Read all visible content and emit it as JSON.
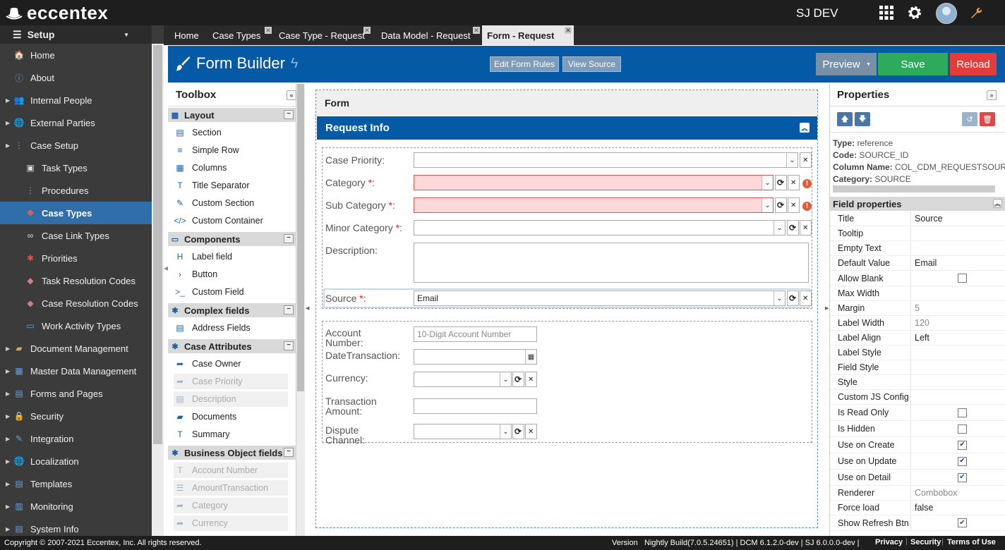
{
  "topbar": {
    "logo": "eccentex",
    "user": "SJ DEV"
  },
  "sidebar": {
    "header": "Setup",
    "items": [
      {
        "label": "Home",
        "icon": "home-icon",
        "indent": 0,
        "arrow": false
      },
      {
        "label": "About",
        "icon": "info-icon",
        "indent": 0,
        "arrow": false
      },
      {
        "label": "Internal People",
        "icon": "people-icon",
        "indent": 0,
        "arrow": true
      },
      {
        "label": "External Parties",
        "icon": "globe-icon",
        "indent": 0,
        "arrow": true
      },
      {
        "label": "Case Setup",
        "icon": "tree-icon",
        "indent": 0,
        "arrow": true
      },
      {
        "label": "Task Types",
        "icon": "cube-icon",
        "indent": 1,
        "arrow": false
      },
      {
        "label": "Procedures",
        "icon": "procedure-icon",
        "indent": 1,
        "arrow": false
      },
      {
        "label": "Case Types",
        "icon": "case-types-icon",
        "indent": 1,
        "arrow": false,
        "active": true
      },
      {
        "label": "Case Link Types",
        "icon": "link-icon",
        "indent": 1,
        "arrow": false
      },
      {
        "label": "Priorities",
        "icon": "priority-icon",
        "indent": 1,
        "arrow": false
      },
      {
        "label": "Task Resolution Codes",
        "icon": "tag-icon",
        "indent": 1,
        "arrow": false
      },
      {
        "label": "Case Resolution Codes",
        "icon": "tag-icon",
        "indent": 1,
        "arrow": false
      },
      {
        "label": "Work Activity Types",
        "icon": "activity-icon",
        "indent": 1,
        "arrow": false
      },
      {
        "label": "Document Management",
        "icon": "folder-icon",
        "indent": 0,
        "arrow": true
      },
      {
        "label": "Master Data Management",
        "icon": "grid-icon",
        "indent": 0,
        "arrow": true
      },
      {
        "label": "Forms and Pages",
        "icon": "form-icon",
        "indent": 0,
        "arrow": true
      },
      {
        "label": "Security",
        "icon": "lock-icon",
        "indent": 0,
        "arrow": true
      },
      {
        "label": "Integration",
        "icon": "plug-icon",
        "indent": 0,
        "arrow": true
      },
      {
        "label": "Localization",
        "icon": "globe-icon",
        "indent": 0,
        "arrow": true
      },
      {
        "label": "Templates",
        "icon": "template-icon",
        "indent": 0,
        "arrow": true
      },
      {
        "label": "Monitoring",
        "icon": "monitor-icon",
        "indent": 0,
        "arrow": true
      },
      {
        "label": "System Info",
        "icon": "system-icon",
        "indent": 0,
        "arrow": true
      }
    ]
  },
  "tabs": [
    {
      "label": "Home",
      "closable": false
    },
    {
      "label": "Case Types",
      "closable": true
    },
    {
      "label": "Case Type - Request",
      "closable": true
    },
    {
      "label": "Data Model - Request",
      "closable": true
    },
    {
      "label": "Form - Request",
      "closable": true,
      "active": true
    }
  ],
  "header": {
    "title": "Form Builder",
    "edit_rules": "Edit Form Rules",
    "view_source": "View Source",
    "preview": "Preview",
    "save": "Save",
    "reload": "Reload"
  },
  "toolbox": {
    "title": "Toolbox",
    "groups": [
      {
        "label": "Layout",
        "items": [
          {
            "label": "Section",
            "icon": "section-icon",
            "disabled": false
          },
          {
            "label": "Simple Row",
            "icon": "row-icon",
            "disabled": false
          },
          {
            "label": "Columns",
            "icon": "columns-icon",
            "disabled": false
          },
          {
            "label": "Title Separator",
            "icon": "title-icon",
            "disabled": false
          },
          {
            "label": "Custom Section",
            "icon": "custom-section-icon",
            "disabled": false
          },
          {
            "label": "Custom Container",
            "icon": "code-icon",
            "disabled": false
          }
        ]
      },
      {
        "label": "Components",
        "items": [
          {
            "label": "Label field",
            "icon": "label-icon",
            "disabled": false
          },
          {
            "label": "Button",
            "icon": "button-icon",
            "disabled": false
          },
          {
            "label": "Custom Field",
            "icon": "terminal-icon",
            "disabled": false
          }
        ]
      },
      {
        "label": "Complex fields",
        "items": [
          {
            "label": "Address Fields",
            "icon": "address-icon",
            "disabled": false
          }
        ]
      },
      {
        "label": "Case Attributes",
        "items": [
          {
            "label": "Case Owner",
            "icon": "share-icon",
            "disabled": false
          },
          {
            "label": "Case Priority",
            "icon": "share-icon",
            "disabled": true
          },
          {
            "label": "Description",
            "icon": "description-icon",
            "disabled": true
          },
          {
            "label": "Documents",
            "icon": "folder-icon",
            "disabled": false
          },
          {
            "label": "Summary",
            "icon": "title-icon",
            "disabled": false
          }
        ]
      },
      {
        "label": "Business Object fields",
        "items": [
          {
            "label": "Account Number",
            "icon": "title-icon",
            "disabled": true
          },
          {
            "label": "AmountTransaction",
            "icon": "list-icon",
            "disabled": true
          },
          {
            "label": "Category",
            "icon": "share-icon",
            "disabled": true
          },
          {
            "label": "Currency",
            "icon": "share-icon",
            "disabled": true
          }
        ]
      }
    ]
  },
  "form": {
    "title": "Form",
    "section_title": "Request Info",
    "fields1": [
      {
        "label": "Case Priority:",
        "required": false,
        "value": "",
        "error": false,
        "type": "combo"
      },
      {
        "label": "Category",
        "required": true,
        "value": "",
        "error": true,
        "type": "combo-refresh"
      },
      {
        "label": "Sub Category",
        "required": true,
        "value": "",
        "error": true,
        "type": "combo-refresh"
      },
      {
        "label": "Minor Category",
        "required": true,
        "value": "",
        "error": false,
        "type": "combo-refresh"
      },
      {
        "label": "Description:",
        "required": false,
        "value": "",
        "error": false,
        "type": "textarea"
      },
      {
        "label": "Source",
        "required": true,
        "value": "Email",
        "error": false,
        "type": "combo-refresh"
      }
    ],
    "fields2": [
      {
        "label": "Account Number:",
        "placeholder": "10-Digit Account Number",
        "type": "text"
      },
      {
        "label": "DateTransaction:",
        "type": "date"
      },
      {
        "label": "Currency:",
        "type": "combo-refresh"
      },
      {
        "label": "Transaction Amount:",
        "type": "text"
      },
      {
        "label": "Dispute Channel:",
        "type": "combo-refresh"
      }
    ]
  },
  "properties": {
    "title": "Properties",
    "info": [
      {
        "key": "Type:",
        "value": "reference"
      },
      {
        "key": "Code:",
        "value": "SOURCE_ID"
      },
      {
        "key": "Column Name:",
        "value": "COL_CDM_REQUESTSOURC"
      },
      {
        "key": "Category:",
        "value": "SOURCE"
      }
    ],
    "field_props_title": "Field properties",
    "rows": [
      {
        "name": "Title",
        "value": "Source",
        "type": "text"
      },
      {
        "name": "Tooltip",
        "value": "",
        "type": "text"
      },
      {
        "name": "Empty Text",
        "value": "",
        "type": "text"
      },
      {
        "name": "Default Value",
        "value": "Email",
        "type": "text"
      },
      {
        "name": "Allow Blank",
        "value": "",
        "type": "check",
        "checked": false
      },
      {
        "name": "Max Width",
        "value": "",
        "type": "text"
      },
      {
        "name": "Margin",
        "value": "5",
        "type": "gray"
      },
      {
        "name": "Label Width",
        "value": "120",
        "type": "gray"
      },
      {
        "name": "Label Align",
        "value": "Left",
        "type": "text"
      },
      {
        "name": "Label Style",
        "value": "",
        "type": "text"
      },
      {
        "name": "Field Style",
        "value": "",
        "type": "text"
      },
      {
        "name": "Style",
        "value": "",
        "type": "text"
      },
      {
        "name": "Custom JS Config",
        "value": "",
        "type": "text"
      },
      {
        "name": "Is Read Only",
        "value": "",
        "type": "check",
        "checked": false
      },
      {
        "name": "Is Hidden",
        "value": "",
        "type": "check",
        "checked": false
      },
      {
        "name": "Use on Create",
        "value": "",
        "type": "check",
        "checked": true
      },
      {
        "name": "Use on Update",
        "value": "",
        "type": "check",
        "checked": true
      },
      {
        "name": "Use on Detail",
        "value": "",
        "type": "check",
        "checked": true
      },
      {
        "name": "Renderer",
        "value": "Combobox",
        "type": "gray"
      },
      {
        "name": "Force load",
        "value": "false",
        "type": "text"
      },
      {
        "name": "Show Refresh Btn",
        "value": "",
        "type": "check",
        "checked": true
      }
    ]
  },
  "footer": {
    "copyright": "Copyright © 2007-2021 Eccentex, Inc. All rights reserved.",
    "version_label": "Version",
    "version": "Nightly Build(7.0.5.24651) | DCM 6.1.2.0-dev | SJ 6.0.0.0-dev |",
    "links": [
      "Privacy",
      "Security",
      "Terms of Use"
    ]
  },
  "colors": {
    "accent": "#055aa6",
    "save": "#2eaa5c",
    "reload": "#e63b3b",
    "active_nav": "#2f6ea8"
  }
}
